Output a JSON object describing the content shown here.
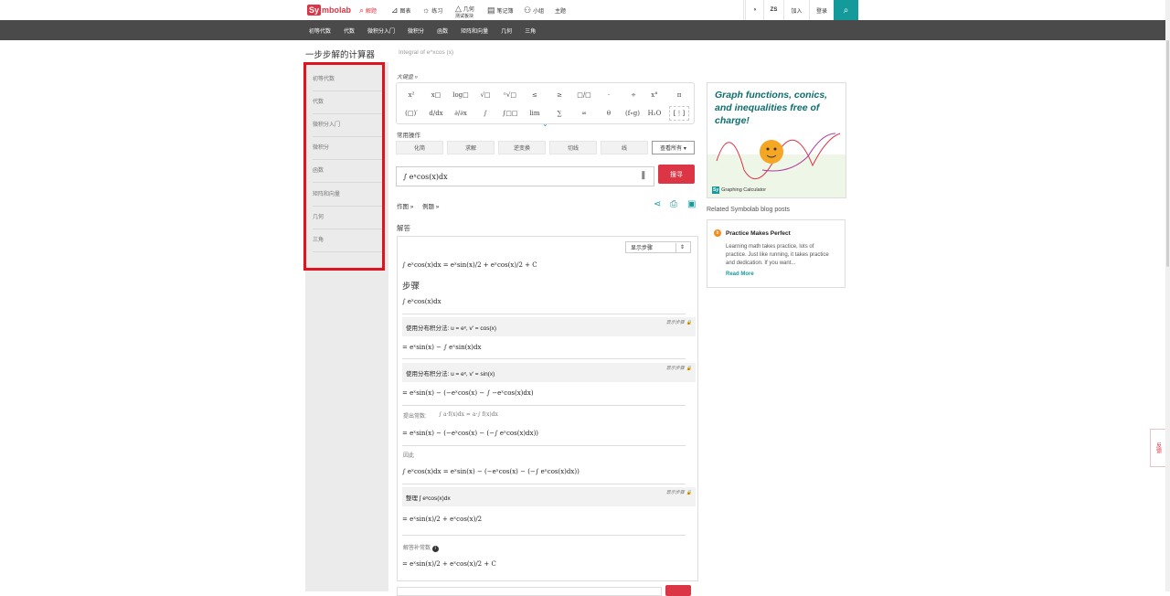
{
  "topbar": {
    "logo_box": "Sy",
    "logo_rest": "mbolab",
    "nav": [
      {
        "label": "解题",
        "icon": "search-icon"
      },
      {
        "label": "图表",
        "icon": "chart-icon"
      },
      {
        "label": "练习",
        "icon": "bulb-icon"
      },
      {
        "label": "几何",
        "icon": "triangle-icon"
      },
      {
        "label": "测试板块",
        "icon": ""
      },
      {
        "label": "笔记簿",
        "icon": "notebook-icon"
      },
      {
        "label": "小组",
        "icon": "group-icon"
      },
      {
        "label": "主题",
        "icon": ""
      }
    ],
    "right": {
      "lang": "ZS",
      "join": "加入",
      "login": "登录"
    }
  },
  "subnav": [
    "初等代数",
    "代数",
    "微积分入门",
    "微积分",
    "函数",
    "矩阵和向量",
    "几何",
    "三角"
  ],
  "page": {
    "title": "一步步解的计算器",
    "crumb": "Integral of e^xcos (x)"
  },
  "sidebar": [
    "初等代数",
    "代数",
    "微积分入门",
    "微积分",
    "函数",
    "矩阵和向量",
    "几何",
    "三角"
  ],
  "keyboard": {
    "toggle": "大键盘 »",
    "row1": [
      "x²",
      "x□",
      "log□",
      "√□",
      "ⁿ√□",
      "≤",
      "≥",
      "□/□",
      "·",
      "÷",
      "x°",
      "π"
    ],
    "row2": [
      "(□)′",
      "d/dx",
      "∂/∂x",
      "∫",
      "∫□□",
      "lim",
      "∑",
      "∞",
      "θ",
      "(f∘g)",
      "H₂O",
      "[⋮]"
    ]
  },
  "operations": {
    "label": "常用操作",
    "buttons": [
      "化简",
      "求解",
      "逆变换",
      "切线",
      "线"
    ],
    "view_all": "查看所有 ▾"
  },
  "input": {
    "expression": "∫ eˣcos(x)dx",
    "go": "搜寻"
  },
  "links": {
    "plot": "作图 »",
    "examples": "例题 »"
  },
  "answer": {
    "label": "解答",
    "show_steps_select": "显示步骤",
    "result": "∫ eˣcos(x)dx = eˣsin(x)/2 + eˣcos(x)/2 + C",
    "steps_heading": "步骤",
    "integral": "∫ eˣcos(x)dx",
    "s1_label": "使用分布积分法: u = eˣ, v′ = cos(x)",
    "s1_res": "= eˣsin(x) − ∫ eˣsin(x)dx",
    "s2_label": "使用分布积分法: u = eˣ, v′ = sin(x)",
    "s2_res": "= eˣsin(x) − (−eˣcos(x) − ∫ −eˣcos(x)dx)",
    "s3_note": "提出常数:",
    "s3_rule": "∫ a·f(x)dx = a·∫ f(x)dx",
    "s3_res": "= eˣsin(x) − (−eˣcos(x) − (−∫ eˣcos(x)dx))",
    "s4_note": "因此",
    "s4_res": "∫ eˣcos(x)dx = eˣsin(x) − (−eˣcos(x) − (−∫ eˣcos(x)dx))",
    "s5_label": "整理 ∫ eˣcos(x)dx",
    "s5_res": "= eˣsin(x)/2 + eˣcos(x)/2",
    "s6_note": "解答补常数",
    "s6_res": "= eˣsin(x)/2 + eˣcos(x)/2 + C",
    "show_steps": "显示步骤"
  },
  "ad": {
    "headline": "Graph functions, conics, and inequalities free of charge!",
    "badge": "Sy",
    "product": "Graphing Calculator"
  },
  "blog": {
    "section": "Related Symbolab blog posts",
    "title": "Practice Makes Perfect",
    "body": "Learning math takes practice, lots of practice. Just like running, it takes practice and dedication. If you want...",
    "more": "Read More"
  },
  "feedback": "反馈",
  "colors": {
    "brand_red": "#dc3545",
    "teal": "#159a9c",
    "dark_nav": "#4a4a4a"
  }
}
